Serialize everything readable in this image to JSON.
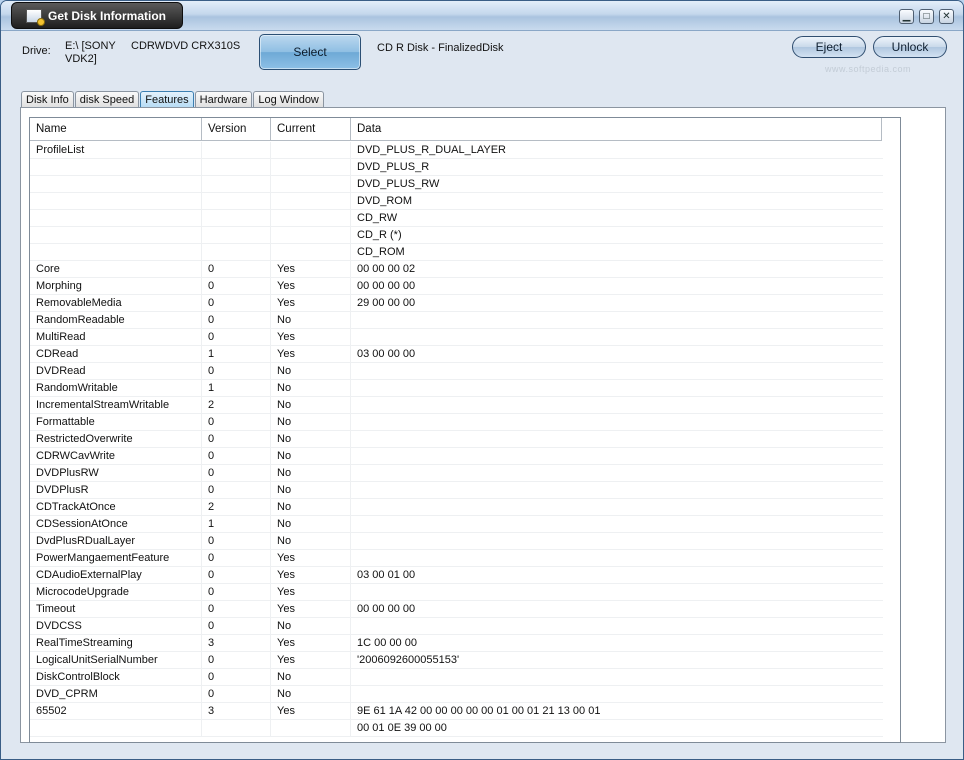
{
  "window": {
    "title": "Get Disk Information"
  },
  "window_controls": {
    "minimize": "▁",
    "maximize": "□",
    "close": "✕"
  },
  "drive": {
    "label": "Drive:",
    "name": "E:\\ [SONY VDK2]",
    "model": "CDRWDVD CRX310S",
    "select_label": "Select",
    "status": "CD R Disk - FinalizedDisk"
  },
  "actions": {
    "eject_label": "Eject",
    "unlock_label": "Unlock"
  },
  "watermark": "www.softpedia.com",
  "tabs": [
    "Disk Info",
    "disk Speed",
    "Features",
    "Hardware",
    "Log Window"
  ],
  "active_tab": "Features",
  "table": {
    "columns": [
      "Name",
      "Version",
      "Current",
      "Data"
    ],
    "rows": [
      [
        "ProfileList",
        "",
        "",
        "DVD_PLUS_R_DUAL_LAYER"
      ],
      [
        "",
        "",
        "",
        "DVD_PLUS_R"
      ],
      [
        "",
        "",
        "",
        "DVD_PLUS_RW"
      ],
      [
        "",
        "",
        "",
        "DVD_ROM"
      ],
      [
        "",
        "",
        "",
        "CD_RW"
      ],
      [
        "",
        "",
        "",
        "CD_R  (*)"
      ],
      [
        "",
        "",
        "",
        "CD_ROM"
      ],
      [
        "Core",
        "0",
        "Yes",
        " 00 00 00 02"
      ],
      [
        "Morphing",
        "0",
        "Yes",
        " 00 00 00 00"
      ],
      [
        "RemovableMedia",
        "0",
        "Yes",
        " 29 00 00 00"
      ],
      [
        "RandomReadable",
        "0",
        "No",
        ""
      ],
      [
        "MultiRead",
        "0",
        "Yes",
        ""
      ],
      [
        "CDRead",
        "1",
        "Yes",
        " 03 00 00 00"
      ],
      [
        "DVDRead",
        "0",
        "No",
        ""
      ],
      [
        "RandomWritable",
        "1",
        "No",
        ""
      ],
      [
        "IncrementalStreamWritable",
        "2",
        "No",
        ""
      ],
      [
        "Formattable",
        "0",
        "No",
        ""
      ],
      [
        "RestrictedOverwrite",
        "0",
        "No",
        ""
      ],
      [
        "CDRWCavWrite",
        "0",
        "No",
        ""
      ],
      [
        "DVDPlusRW",
        "0",
        "No",
        ""
      ],
      [
        "DVDPlusR",
        "0",
        "No",
        ""
      ],
      [
        "CDTrackAtOnce",
        "2",
        "No",
        ""
      ],
      [
        "CDSessionAtOnce",
        "1",
        "No",
        ""
      ],
      [
        "DvdPlusRDualLayer",
        "0",
        "No",
        ""
      ],
      [
        "PowerMangaementFeature",
        "0",
        "Yes",
        ""
      ],
      [
        "CDAudioExternalPlay",
        "0",
        "Yes",
        " 03 00 01 00"
      ],
      [
        "MicrocodeUpgrade",
        "0",
        "Yes",
        ""
      ],
      [
        "Timeout",
        "0",
        "Yes",
        " 00 00 00 00"
      ],
      [
        "DVDCSS",
        "0",
        "No",
        ""
      ],
      [
        "RealTimeStreaming",
        "3",
        "Yes",
        " 1C 00 00 00"
      ],
      [
        "LogicalUnitSerialNumber",
        "0",
        "Yes",
        "'2006092600055153'"
      ],
      [
        "DiskControlBlock",
        "0",
        "No",
        ""
      ],
      [
        "DVD_CPRM",
        "0",
        "No",
        ""
      ],
      [
        "65502",
        "3",
        "Yes",
        " 9E 61 1A 42 00 00 00 00 00 01 00 01 21 13 00 01"
      ],
      [
        "",
        "",
        "",
        " 00 01 0E 39 00 00"
      ]
    ]
  }
}
